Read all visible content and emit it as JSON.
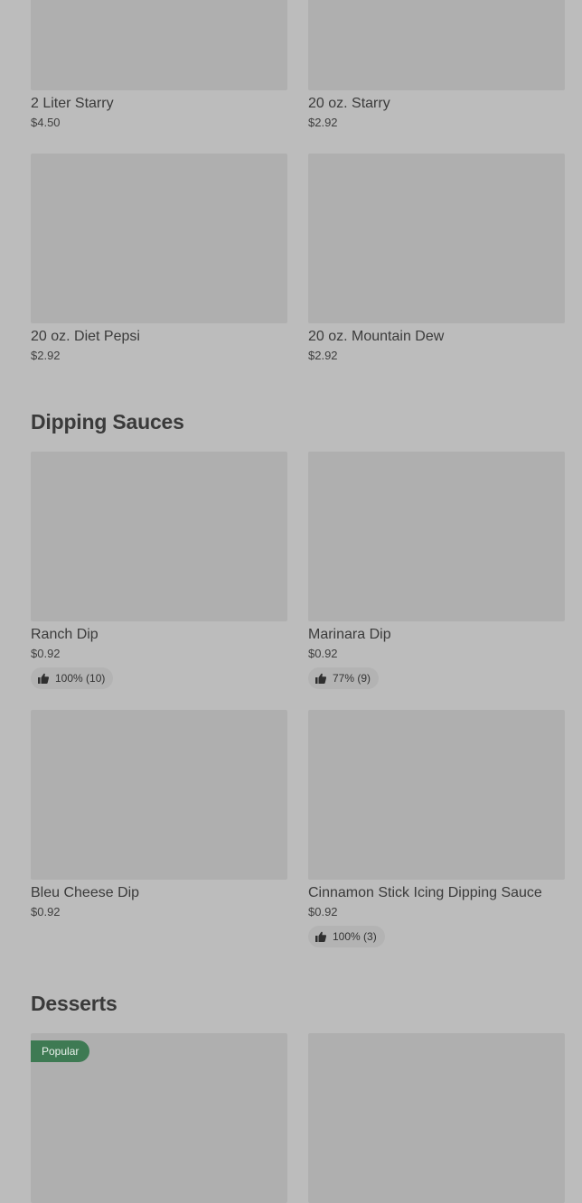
{
  "drinks": [
    {
      "name": "2 Liter Starry",
      "price": "$4.50"
    },
    {
      "name": "20 oz. Starry",
      "price": "$2.92"
    },
    {
      "name": "20 oz. Diet Pepsi",
      "price": "$2.92"
    },
    {
      "name": "20 oz. Mountain Dew",
      "price": "$2.92"
    }
  ],
  "dipping_sauces": {
    "title": "Dipping Sauces",
    "items": [
      {
        "name": "Ranch Dip",
        "price": "$0.92",
        "rating": "100% (10)"
      },
      {
        "name": "Marinara Dip",
        "price": "$0.92",
        "rating": "77% (9)"
      },
      {
        "name": "Bleu Cheese Dip",
        "price": "$0.92"
      },
      {
        "name": "Cinnamon Stick Icing Dipping Sauce",
        "price": "$0.92",
        "rating": "100% (3)"
      }
    ]
  },
  "desserts": {
    "title": "Desserts",
    "items": [
      {
        "badge": "Popular"
      },
      {}
    ]
  },
  "icons": {
    "rating": "thumbs-up-icon"
  },
  "colors": {
    "background": "#bcbcbc",
    "image_placeholder": "#afafaf",
    "popular_badge": "#3e7a53"
  }
}
